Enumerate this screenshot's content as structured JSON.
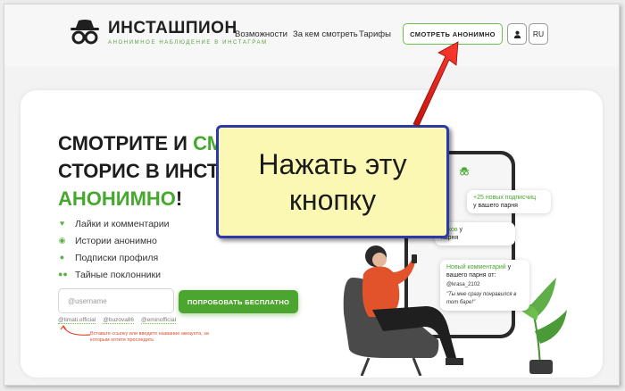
{
  "header": {
    "logo_title": "ИНСТАШПИОН",
    "logo_subtitle": "АНОНИМНОЕ НАБЛЮДЕНИЕ В ИНСТАГРАМ",
    "nav": [
      "Возможности",
      "За кем смотреть",
      "Тарифы"
    ],
    "watch_button": "СМОТРЕТЬ АНОНИМНО",
    "lang_button": "RU"
  },
  "hero": {
    "title_line1_a": "СМОТРИТЕ И ",
    "title_line1_b": "СМ",
    "title_line2": "СТОРИС В ИНСТ",
    "title_line3": "АНОНИМНО",
    "title_line3_end": "!",
    "features": [
      {
        "icon": "heart-icon",
        "label": "Лайки и комментарии"
      },
      {
        "icon": "eye-icon",
        "label": "Истории анонимно"
      },
      {
        "icon": "user-icon",
        "label": "Подписки профиля"
      },
      {
        "icon": "users-icon",
        "label": "Тайные поклонники"
      }
    ],
    "input_placeholder": "@username",
    "try_button": "ПОПРОБОВАТЬ БЕСПЛАТНО",
    "examples": [
      "@timati.official",
      "@buzova86",
      "@eminofficial"
    ],
    "hint": "Вставьте ссылку или введите название аккаунта, за которым хотите проследить"
  },
  "notifications": {
    "n1_green": "+25 новых подписчиц",
    "n1_rest": "у вашего парня",
    "n2_green": "айков",
    "n2_rest_a": " у",
    "n2_rest_b": "парня",
    "n3_green": "Новый комментарий",
    "n3_rest": " у вашего парня от:",
    "n3_user": "@krasa_2102",
    "n3_quote": "\"Ты мне сразу понравился в тот баре!\""
  },
  "overlay": {
    "line1": "Нажать эту",
    "line2": "кнопку"
  },
  "colors": {
    "accent_green": "#46a82f",
    "callout_bg": "#fbf8b4",
    "callout_border": "#2b3aa7",
    "arrow_red": "#e0241b"
  }
}
